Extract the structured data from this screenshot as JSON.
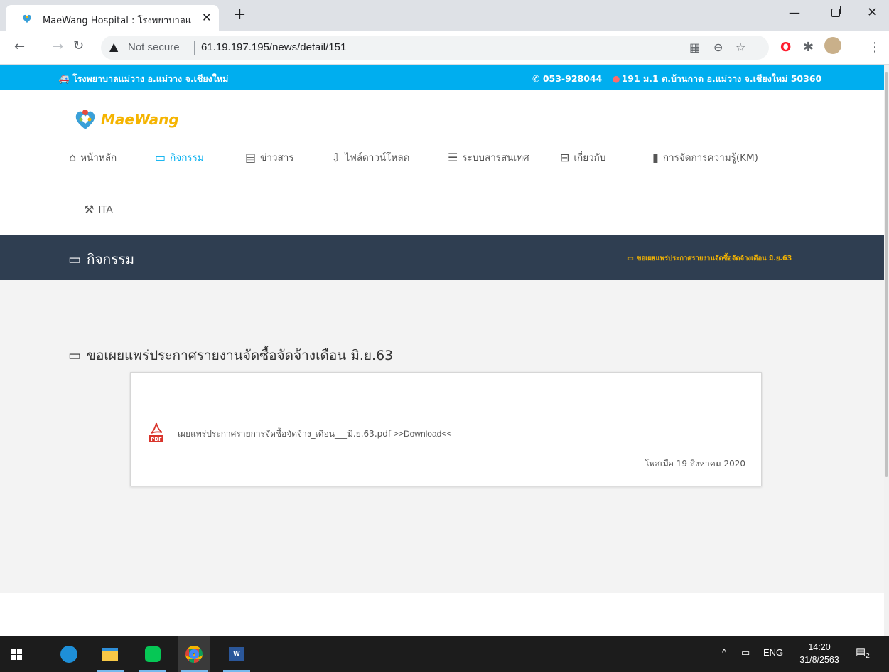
{
  "browser": {
    "tab_title": "MaeWang Hospital : โรงพยาบาลแ",
    "tab_close": "✕",
    "new_tab": "+",
    "not_secure": "Not secure",
    "url": "61.19.197.195/news/detail/151",
    "window_controls": {
      "minimize": "—",
      "close": "✕"
    }
  },
  "site": {
    "topbar": {
      "hospital": "โรงพยาบาลแม่วาง อ.แม่วาง จ.เชียงใหม่",
      "phone": "053-928044",
      "address": "191 ม.1 ต.บ้านกาด อ.แม่วาง จ.เชียงใหม่ 50360"
    },
    "logo_text": "MaeWang",
    "menu": [
      {
        "label": "หน้าหลัก",
        "icon": "home-icon",
        "active": false
      },
      {
        "label": "กิจกรรม",
        "icon": "monitor-icon",
        "active": true
      },
      {
        "label": "ข่าวสาร",
        "icon": "newspaper-icon",
        "active": false
      },
      {
        "label": "ไฟล์ดาวน์โหลด",
        "icon": "download-icon",
        "active": false
      },
      {
        "label": "ระบบสารสนเทศ",
        "icon": "database-icon",
        "active": false
      },
      {
        "label": "เกี่ยวกับ",
        "icon": "hdd-icon",
        "active": false
      },
      {
        "label": "การจัดการความรู้(KM)",
        "icon": "book-icon",
        "active": false
      },
      {
        "label": "ITA",
        "icon": "gavel-icon",
        "active": false
      }
    ],
    "pagebar": {
      "title": "กิจกรรม",
      "breadcrumb": "ขอเผยแพร่ประกาศรายงานจัดซื้อจัดจ้างเดือน มิ.ย.63"
    },
    "article": {
      "title": "ขอเผยแพร่ประกาศรายงานจัดซื้อจัดจ้างเดือน มิ.ย.63",
      "file_name": "เผยแพร่ประกาศรายการจัดซื้อจัดจ้าง_เดือน___มิ.ย.63.pdf",
      "download_label": ">>Download<<",
      "posted": "โพสเมื่อ 19 สิงหาคม 2020"
    }
  },
  "taskbar": {
    "language": "ENG",
    "time": "14:20",
    "date": "31/8/2563",
    "notifications": "2"
  },
  "colors": {
    "accent": "#00aeef",
    "pagebar": "#2f3e51",
    "logo": "#f5b400"
  }
}
